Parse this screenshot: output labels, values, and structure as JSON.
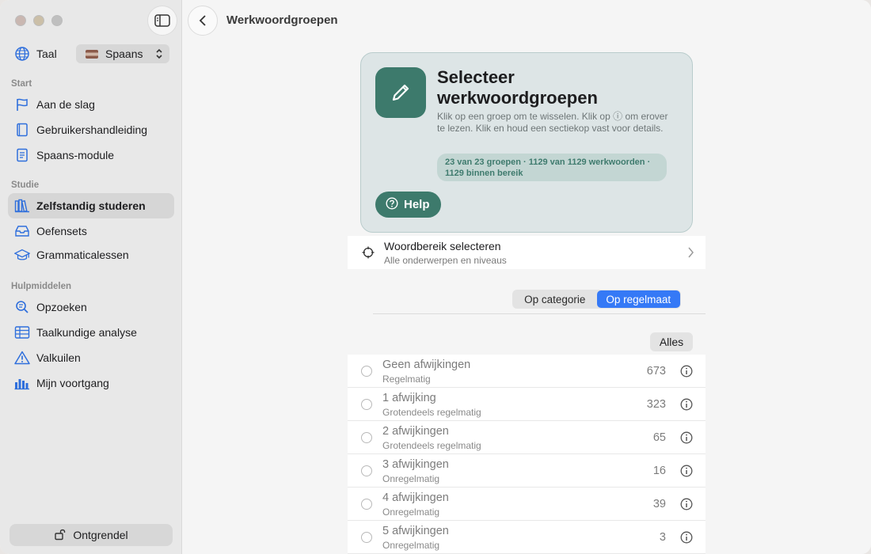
{
  "sidebar": {
    "language_label": "Taal",
    "language_value": "Spaans",
    "sections": [
      {
        "title": "Start",
        "items": [
          {
            "label": "Aan de slag",
            "icon": "flag-icon"
          },
          {
            "label": "Gebruikershandleiding",
            "icon": "book-icon"
          },
          {
            "label": "Spaans-module",
            "icon": "document-icon"
          }
        ]
      },
      {
        "title": "Studie",
        "items": [
          {
            "label": "Zelfstandig studeren",
            "icon": "books-icon",
            "active": true
          },
          {
            "label": "Oefensets",
            "icon": "tray-icon"
          },
          {
            "label": "Grammaticalessen",
            "icon": "graduation-cap-icon"
          }
        ]
      },
      {
        "title": "Hulpmiddelen",
        "items": [
          {
            "label": "Opzoeken",
            "icon": "magnifier-icon"
          },
          {
            "label": "Taalkundige analyse",
            "icon": "table-icon"
          },
          {
            "label": "Valkuilen",
            "icon": "warning-icon"
          },
          {
            "label": "Mijn voortgang",
            "icon": "bar-chart-icon"
          }
        ]
      }
    ],
    "unlock_label": "Ontgrendel"
  },
  "header": {
    "title": "Werkwoordgroepen"
  },
  "hero": {
    "title": "Selecteer werkwoordgroepen",
    "description": "Klik op een groep om te wisselen. Klik op ⓘ om erover te lezen. Klik en houd een sectiekop vast voor details.",
    "badge": "23 van 23 groepen · 1129 van 1129 werkwoorden · 1129 binnen bereik",
    "help_label": "Help",
    "accent": "#3d7a6c"
  },
  "range": {
    "title": "Woordbereik selecteren",
    "subtitle": "Alle onderwerpen en niveaus"
  },
  "segmented": {
    "options": [
      "Op categorie",
      "Op regelmaat"
    ],
    "selected": "Op regelmaat"
  },
  "all_label": "Alles",
  "groups": [
    {
      "title": "Geen afwijkingen",
      "subtitle": "Regelmatig",
      "count": "673"
    },
    {
      "title": "1 afwijking",
      "subtitle": "Grotendeels regelmatig",
      "count": "323"
    },
    {
      "title": "2 afwijkingen",
      "subtitle": "Grotendeels regelmatig",
      "count": "65"
    },
    {
      "title": "3 afwijkingen",
      "subtitle": "Onregelmatig",
      "count": "16"
    },
    {
      "title": "4 afwijkingen",
      "subtitle": "Onregelmatig",
      "count": "39"
    },
    {
      "title": "5 afwijkingen",
      "subtitle": "Onregelmatig",
      "count": "3"
    }
  ]
}
